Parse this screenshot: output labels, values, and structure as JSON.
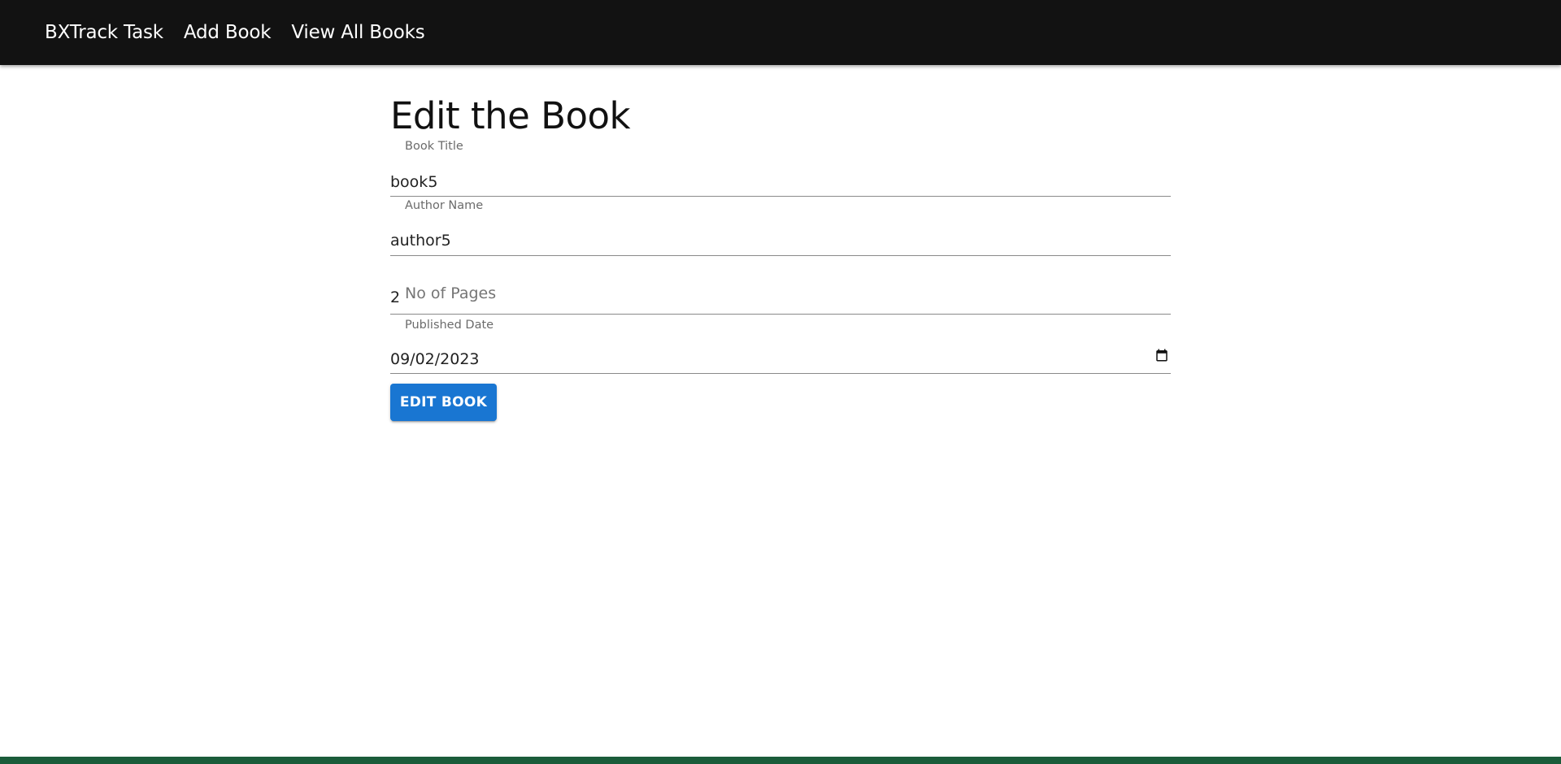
{
  "nav": {
    "brand": "BXTrack Task",
    "links": [
      "Add Book",
      "View All Books"
    ]
  },
  "page": {
    "title": "Edit the Book"
  },
  "form": {
    "book_title": {
      "label": "Book Title",
      "value": "book5"
    },
    "author_name": {
      "label": "Author Name",
      "value": "author5"
    },
    "pages": {
      "value": "2",
      "placeholder": "No of Pages"
    },
    "published_date": {
      "label": "Published Date",
      "value": "09/02/2023",
      "icon": "calendar-icon"
    },
    "submit_label": "EDIT BOOK"
  },
  "colors": {
    "navbar_bg": "#121212",
    "button_bg": "#1976d2",
    "footer_bar": "#1a5c3a"
  }
}
